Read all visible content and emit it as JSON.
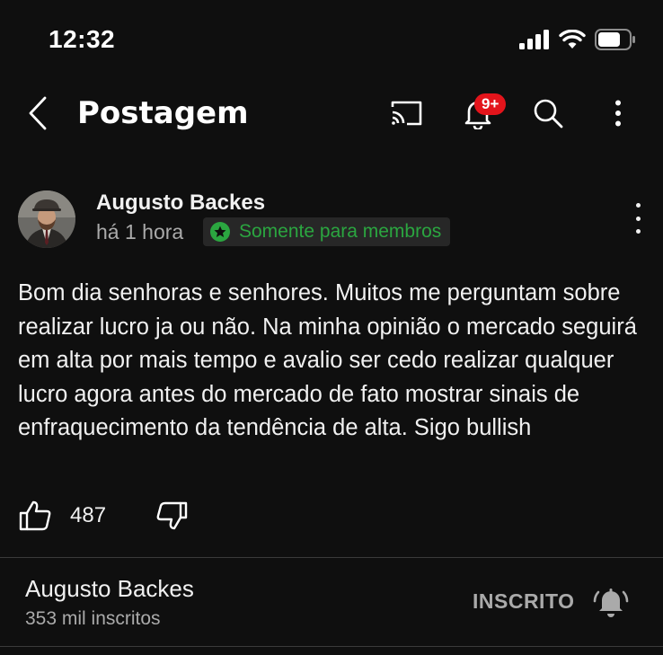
{
  "status_bar": {
    "time": "12:32",
    "signal_icon": "cellular-signal-icon",
    "wifi_icon": "wifi-icon",
    "battery_icon": "battery-icon"
  },
  "header": {
    "title": "Postagem",
    "back_icon": "chevron-left-icon",
    "cast_icon": "cast-icon",
    "notifications_icon": "bell-icon",
    "notifications_badge": "9+",
    "search_icon": "search-icon",
    "more_icon": "more-vertical-icon"
  },
  "post": {
    "author": "Augusto Backes",
    "time_ago": "há 1 hora",
    "members_chip": "Somente para membros",
    "body": "Bom dia senhoras e senhores. Muitos me perguntam sobre realizar lucro ja ou não. Na minha opinião o mercado seguirá em alta por mais tempo e avalio ser cedo realizar qualquer lucro agora antes do mercado de fato mostrar sinais de enfraquecimento da tendência de alta. Sigo bullish",
    "likes": "487"
  },
  "channel": {
    "name": "Augusto Backes",
    "subscribers": "353 mil inscritos",
    "subscribed_label": "INSCRITO"
  },
  "colors": {
    "background": "#0f0f0f",
    "badge_red": "#e3141b",
    "members_green": "#2ba640",
    "secondary_text": "#aaaaaa"
  }
}
